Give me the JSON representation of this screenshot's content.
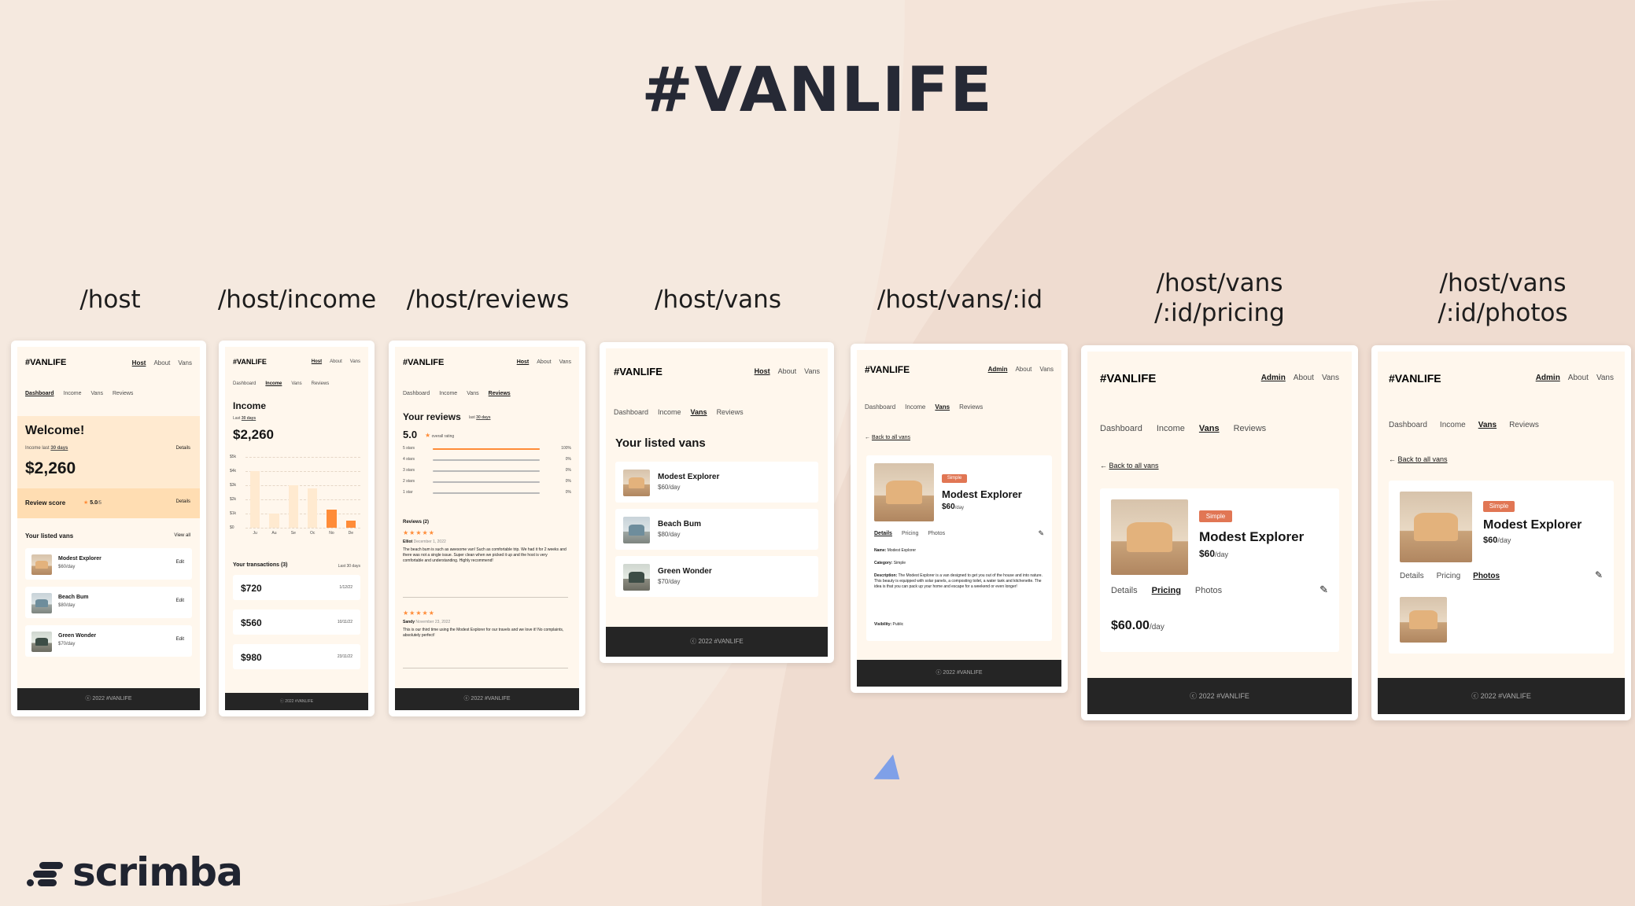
{
  "title": "#VANLIFE",
  "brand": "scrimba",
  "footer_text": "ⓒ 2022 #VANLIFE",
  "logo": "#VANLIFE",
  "routes": [
    "/host",
    "/host/income",
    "/host/reviews",
    "/host/vans",
    "/host/vans/:id",
    "/host/vans\n/:id/pricing",
    "/host/vans\n/:id/photos"
  ],
  "nav_host": [
    "Host",
    "About",
    "Vans"
  ],
  "nav_admin": [
    "Admin",
    "About",
    "Vans"
  ],
  "subnav": [
    "Dashboard",
    "Income",
    "Vans",
    "Reviews"
  ],
  "dashboard": {
    "welcome": "Welcome!",
    "income_text": "Income last",
    "income_period": "30 days",
    "details": "Details",
    "amount": "$2,260",
    "review_score_label": "Review score",
    "review_score": "5.0",
    "review_out_of": "/5",
    "listed_title": "Your listed vans",
    "view_all": "View all",
    "edit": "Edit",
    "vans": [
      {
        "name": "Modest Explorer",
        "price": "$60/day"
      },
      {
        "name": "Beach Bum",
        "price": "$80/day"
      },
      {
        "name": "Green Wonder",
        "price": "$70/day"
      }
    ]
  },
  "income": {
    "title": "Income",
    "period_label": "Last",
    "period": "30 days",
    "amount": "$2,260",
    "y_ticks": [
      "$5k",
      "$4k",
      "$3k",
      "$2k",
      "$1k",
      "$0"
    ],
    "transactions_title": "Your transactions (3)",
    "transactions_period": "Last 30 days",
    "transactions": [
      {
        "amount": "$720",
        "date": "1/12/22"
      },
      {
        "amount": "$560",
        "date": "10/11/22"
      },
      {
        "amount": "$980",
        "date": "23/11/22"
      }
    ]
  },
  "chart_data": {
    "type": "bar",
    "categories": [
      "Ju",
      "Au",
      "Se",
      "Oc",
      "No",
      "De"
    ],
    "values": [
      4000,
      1000,
      3000,
      2800,
      1300,
      500
    ],
    "highlight": [
      "No",
      "De"
    ],
    "ylim": [
      0,
      5000
    ],
    "y_ticks": [
      "$5k",
      "$4k",
      "$3k",
      "$2k",
      "$1k",
      "$0"
    ],
    "colors": {
      "bar": "#ffead0",
      "highlight": "#ff8c38"
    }
  },
  "reviews": {
    "title": "Your reviews",
    "period_label": "last",
    "period": "30 days",
    "score": "5.0",
    "overall": "overall rating",
    "rows": [
      {
        "label": "5 stars",
        "pct": "100%",
        "fill": 1.0
      },
      {
        "label": "4 stars",
        "pct": "0%",
        "fill": 0
      },
      {
        "label": "3 stars",
        "pct": "0%",
        "fill": 0
      },
      {
        "label": "2 stars",
        "pct": "0%",
        "fill": 0
      },
      {
        "label": "1 star",
        "pct": "0%",
        "fill": 0
      }
    ],
    "count_label": "Reviews (2)",
    "items": [
      {
        "name": "Elliot",
        "date": "December 1, 2022",
        "text": "The beach bum is such as awesome van! Such as comfortable trip. We had it for 2 weeks and there was not a single issue. Super clean when we picked it up and the host is very comfortable and understanding. Highly recommend!"
      },
      {
        "name": "Sandy",
        "date": "November 23, 2022",
        "text": "This is our third time using the Modest Explorer for our travels and we love it! No complaints, absolutely perfect!"
      }
    ]
  },
  "host_vans": {
    "title": "Your listed vans",
    "vans": [
      {
        "name": "Modest Explorer",
        "price": "$60/day"
      },
      {
        "name": "Beach Bum",
        "price": "$80/day"
      },
      {
        "name": "Green Wonder",
        "price": "$70/day"
      }
    ]
  },
  "van_detail": {
    "back": "Back to all vans",
    "badge": "Simple",
    "name": "Modest Explorer",
    "price": "$60",
    "per_day": "/day",
    "tabs": [
      "Details",
      "Pricing",
      "Photos"
    ],
    "name_label": "Name:",
    "name_value": "Modest Explorer",
    "category_label": "Category:",
    "category_value": "Simple",
    "description_label": "Description:",
    "description_value": "The Modest Explorer is a van designed to get you out of the house and into nature. This beauty is equipped with solar panels, a composting toilet, a water tank and kitchenette. The idea is that you can pack up your home and escape for a weekend or even longer!",
    "visibility_label": "Visibility:",
    "visibility_value": "Public",
    "pricing_amount": "$60.00",
    "pricing_unit": "/day"
  }
}
